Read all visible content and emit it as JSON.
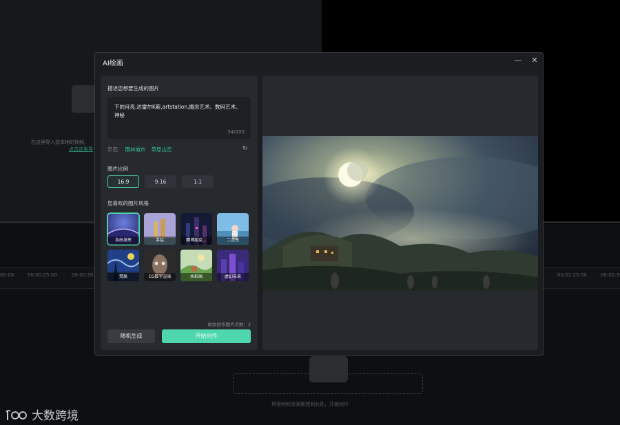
{
  "background": {
    "import_hint": "在这里导入您本地的视频,",
    "import_link": "点击这里导",
    "timeline_labels": [
      "00:00",
      "00:00:25:00",
      "00:00:30",
      "00:01:25:00",
      "00:01:3"
    ],
    "drop_hint": "将视频和资源拖拽到此处，开始创作"
  },
  "watermark": {
    "text": "大数跨境"
  },
  "dialog": {
    "title": "AI绘画",
    "minimize_icon": "minimize-icon",
    "close_icon": "close-icon"
  },
  "form": {
    "describe_label": "描述您想要生成的图片",
    "prompt_text": "下的月亮,达雷尔K斯,artstation,概念艺术、数码艺术、神秘",
    "prompt_count": "34/200",
    "examples_label": "示范:",
    "examples": [
      "雨林城市",
      "草原山峦"
    ],
    "refresh_icon": "refresh-icon",
    "ratio_label": "图片比例",
    "ratios": [
      "16:9",
      "9:16",
      "1:1"
    ],
    "selected_ratio": "16:9",
    "style_label": "您喜欢的图片风格",
    "styles": [
      {
        "name": "自由发挥",
        "selected": true
      },
      {
        "name": "手绘"
      },
      {
        "name": "赛博朋克..."
      },
      {
        "name": "二次元"
      },
      {
        "name": "梵高"
      },
      {
        "name": "CG数字渲染"
      },
      {
        "name": "水彩画"
      },
      {
        "name": "虚幻未来"
      }
    ],
    "remaining": "剩余创作图片次数：2",
    "random_button": "随机生成",
    "create_button": "开始创作"
  },
  "colors": {
    "accent": "#4fd6ad",
    "accent_text": "#35c49a",
    "dialog_bg": "#1b1d20",
    "panel_bg": "#26292d"
  }
}
